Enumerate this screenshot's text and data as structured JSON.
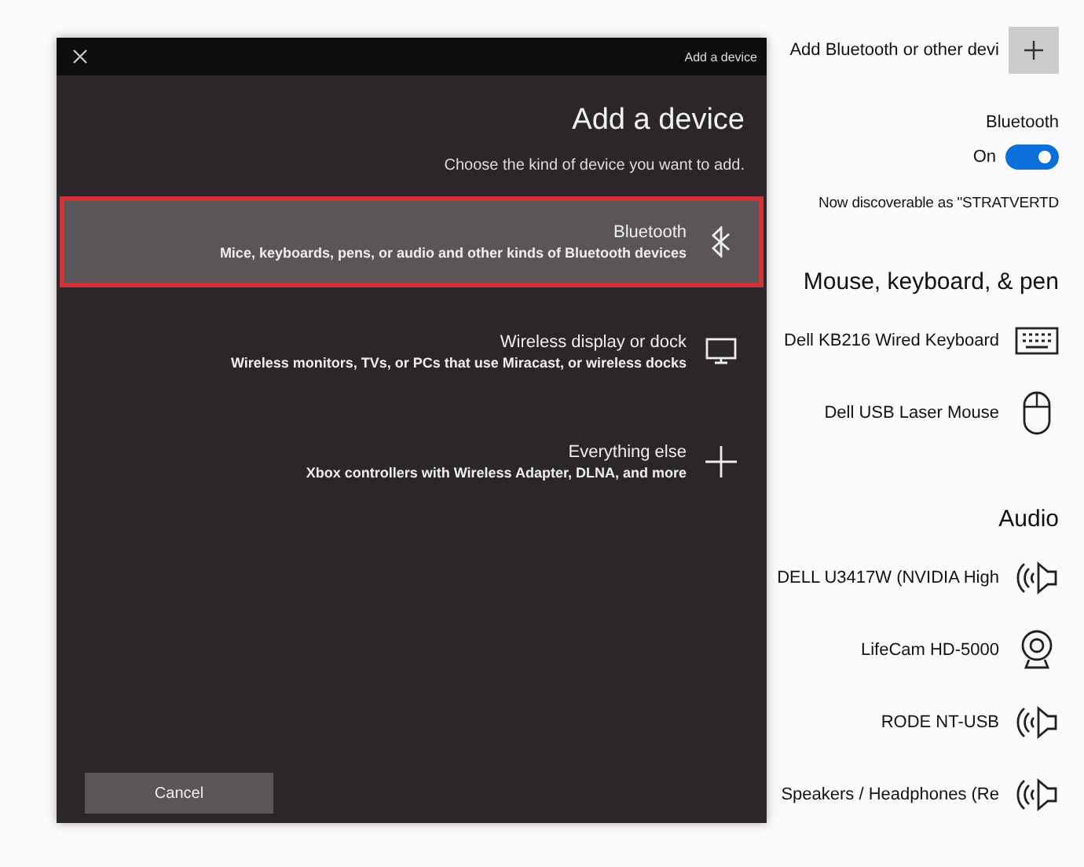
{
  "settings": {
    "add_button": {
      "label": "Add Bluetooth or other devi"
    },
    "bluetooth": {
      "label": "Bluetooth",
      "on": true,
      "state_text": "On"
    },
    "discoverable": "Now discoverable as \"STRATVERTD",
    "sections": [
      {
        "title": "Mouse, keyboard, & pen",
        "devices": [
          {
            "name": "Dell KB216 Wired Keyboard",
            "kind": "keyboard"
          },
          {
            "name": "Dell USB Laser Mouse",
            "kind": "mouse"
          }
        ]
      },
      {
        "title": "Audio",
        "devices": [
          {
            "name": "DELL U3417W (NVIDIA High",
            "kind": "speaker"
          },
          {
            "name": "LifeCam HD-5000",
            "kind": "webcam"
          },
          {
            "name": "RODE NT-USB",
            "kind": "speaker"
          },
          {
            "name": "Speakers / Headphones (Re",
            "kind": "speaker"
          }
        ]
      }
    ]
  },
  "dialog": {
    "window_title": "Add a device",
    "heading": "Add a device",
    "subtitle": "Choose the kind of device you want to add.",
    "options": [
      {
        "title": "Bluetooth",
        "description": "Mice, keyboards, pens, or audio and other kinds of Bluetooth devices",
        "kind": "bluetooth",
        "selected": true
      },
      {
        "title": "Wireless display or dock",
        "description": "Wireless monitors, TVs, or PCs that use Miracast, or wireless docks",
        "kind": "display",
        "selected": false
      },
      {
        "title": "Everything else",
        "description": "Xbox controllers with Wireless Adapter, DLNA, and more",
        "kind": "plus",
        "selected": false
      }
    ],
    "cancel": "Cancel"
  }
}
